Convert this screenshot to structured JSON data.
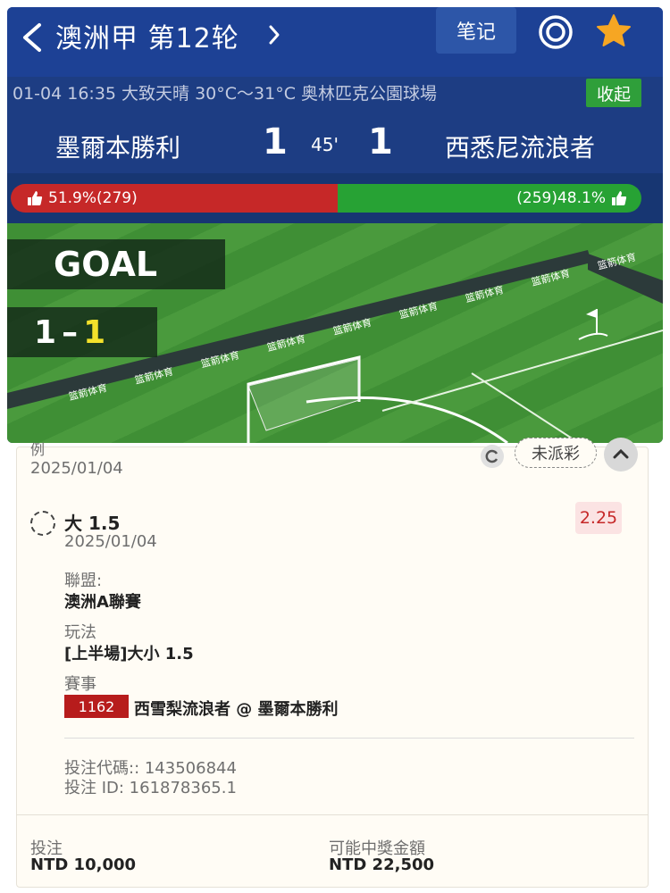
{
  "header": {
    "title": "澳洲甲 第12轮",
    "note_label": "笔记",
    "match_info": "01-04 16:35  大致天晴 30°C～31°C  奥林匹克公園球場",
    "collapse_label": "收起",
    "home_team": "墨爾本勝利",
    "home_score": "1",
    "minute": "45'",
    "away_score": "1",
    "away_team": "西悉尼流浪者",
    "vote_home": "51.9%(279)",
    "vote_home_pct": 51.9,
    "vote_away": "(259)48.1%",
    "colors": {
      "nav": "#1d4195",
      "home": "#c62828",
      "away": "#27a234",
      "accent_star": "#f6a623"
    }
  },
  "pitch": {
    "event": "GOAL",
    "score_left": "1",
    "score_dash": "–",
    "score_right": "1",
    "board_text": "篮箭体育"
  },
  "bet": {
    "cut_label": "例",
    "top_date": "2025/01/04",
    "status": "未派彩",
    "selection": "大 1.5",
    "selection_date": "2025/01/04",
    "odds": "2.25",
    "league_label": "聯盟:",
    "league_value": "澳洲A聯賽",
    "play_label": "玩法",
    "play_value": "[上半場]大小 1.5",
    "event_label": "賽事",
    "event_code": "1162",
    "event_value": "西雪梨流浪者 @ 墨爾本勝利",
    "bet_code": "投注代碼:: 143506844",
    "bet_id": "投注 ID: 161878365.1",
    "stake_label": "投注",
    "stake_value": "NTD 10,000",
    "payout_label": "可能中獎金額",
    "payout_value": "NTD 22,500"
  }
}
